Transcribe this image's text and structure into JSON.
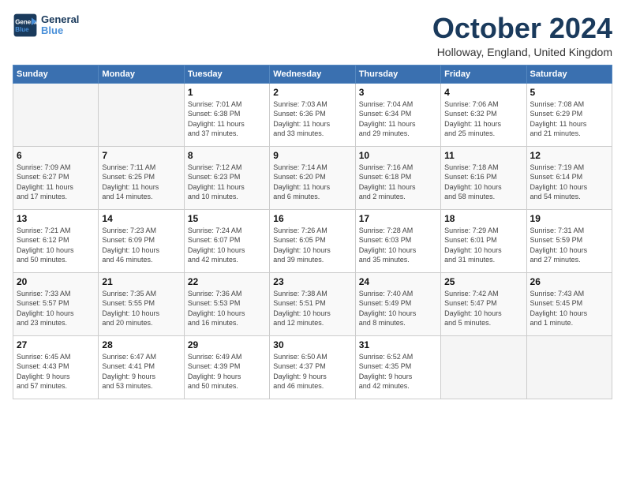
{
  "logo": {
    "text_general": "General",
    "text_blue": "Blue"
  },
  "title": "October 2024",
  "location": "Holloway, England, United Kingdom",
  "days_of_week": [
    "Sunday",
    "Monday",
    "Tuesday",
    "Wednesday",
    "Thursday",
    "Friday",
    "Saturday"
  ],
  "weeks": [
    [
      {
        "day": "",
        "info": ""
      },
      {
        "day": "",
        "info": ""
      },
      {
        "day": "1",
        "info": "Sunrise: 7:01 AM\nSunset: 6:38 PM\nDaylight: 11 hours\nand 37 minutes."
      },
      {
        "day": "2",
        "info": "Sunrise: 7:03 AM\nSunset: 6:36 PM\nDaylight: 11 hours\nand 33 minutes."
      },
      {
        "day": "3",
        "info": "Sunrise: 7:04 AM\nSunset: 6:34 PM\nDaylight: 11 hours\nand 29 minutes."
      },
      {
        "day": "4",
        "info": "Sunrise: 7:06 AM\nSunset: 6:32 PM\nDaylight: 11 hours\nand 25 minutes."
      },
      {
        "day": "5",
        "info": "Sunrise: 7:08 AM\nSunset: 6:29 PM\nDaylight: 11 hours\nand 21 minutes."
      }
    ],
    [
      {
        "day": "6",
        "info": "Sunrise: 7:09 AM\nSunset: 6:27 PM\nDaylight: 11 hours\nand 17 minutes."
      },
      {
        "day": "7",
        "info": "Sunrise: 7:11 AM\nSunset: 6:25 PM\nDaylight: 11 hours\nand 14 minutes."
      },
      {
        "day": "8",
        "info": "Sunrise: 7:12 AM\nSunset: 6:23 PM\nDaylight: 11 hours\nand 10 minutes."
      },
      {
        "day": "9",
        "info": "Sunrise: 7:14 AM\nSunset: 6:20 PM\nDaylight: 11 hours\nand 6 minutes."
      },
      {
        "day": "10",
        "info": "Sunrise: 7:16 AM\nSunset: 6:18 PM\nDaylight: 11 hours\nand 2 minutes."
      },
      {
        "day": "11",
        "info": "Sunrise: 7:18 AM\nSunset: 6:16 PM\nDaylight: 10 hours\nand 58 minutes."
      },
      {
        "day": "12",
        "info": "Sunrise: 7:19 AM\nSunset: 6:14 PM\nDaylight: 10 hours\nand 54 minutes."
      }
    ],
    [
      {
        "day": "13",
        "info": "Sunrise: 7:21 AM\nSunset: 6:12 PM\nDaylight: 10 hours\nand 50 minutes."
      },
      {
        "day": "14",
        "info": "Sunrise: 7:23 AM\nSunset: 6:09 PM\nDaylight: 10 hours\nand 46 minutes."
      },
      {
        "day": "15",
        "info": "Sunrise: 7:24 AM\nSunset: 6:07 PM\nDaylight: 10 hours\nand 42 minutes."
      },
      {
        "day": "16",
        "info": "Sunrise: 7:26 AM\nSunset: 6:05 PM\nDaylight: 10 hours\nand 39 minutes."
      },
      {
        "day": "17",
        "info": "Sunrise: 7:28 AM\nSunset: 6:03 PM\nDaylight: 10 hours\nand 35 minutes."
      },
      {
        "day": "18",
        "info": "Sunrise: 7:29 AM\nSunset: 6:01 PM\nDaylight: 10 hours\nand 31 minutes."
      },
      {
        "day": "19",
        "info": "Sunrise: 7:31 AM\nSunset: 5:59 PM\nDaylight: 10 hours\nand 27 minutes."
      }
    ],
    [
      {
        "day": "20",
        "info": "Sunrise: 7:33 AM\nSunset: 5:57 PM\nDaylight: 10 hours\nand 23 minutes."
      },
      {
        "day": "21",
        "info": "Sunrise: 7:35 AM\nSunset: 5:55 PM\nDaylight: 10 hours\nand 20 minutes."
      },
      {
        "day": "22",
        "info": "Sunrise: 7:36 AM\nSunset: 5:53 PM\nDaylight: 10 hours\nand 16 minutes."
      },
      {
        "day": "23",
        "info": "Sunrise: 7:38 AM\nSunset: 5:51 PM\nDaylight: 10 hours\nand 12 minutes."
      },
      {
        "day": "24",
        "info": "Sunrise: 7:40 AM\nSunset: 5:49 PM\nDaylight: 10 hours\nand 8 minutes."
      },
      {
        "day": "25",
        "info": "Sunrise: 7:42 AM\nSunset: 5:47 PM\nDaylight: 10 hours\nand 5 minutes."
      },
      {
        "day": "26",
        "info": "Sunrise: 7:43 AM\nSunset: 5:45 PM\nDaylight: 10 hours\nand 1 minute."
      }
    ],
    [
      {
        "day": "27",
        "info": "Sunrise: 6:45 AM\nSunset: 4:43 PM\nDaylight: 9 hours\nand 57 minutes."
      },
      {
        "day": "28",
        "info": "Sunrise: 6:47 AM\nSunset: 4:41 PM\nDaylight: 9 hours\nand 53 minutes."
      },
      {
        "day": "29",
        "info": "Sunrise: 6:49 AM\nSunset: 4:39 PM\nDaylight: 9 hours\nand 50 minutes."
      },
      {
        "day": "30",
        "info": "Sunrise: 6:50 AM\nSunset: 4:37 PM\nDaylight: 9 hours\nand 46 minutes."
      },
      {
        "day": "31",
        "info": "Sunrise: 6:52 AM\nSunset: 4:35 PM\nDaylight: 9 hours\nand 42 minutes."
      },
      {
        "day": "",
        "info": ""
      },
      {
        "day": "",
        "info": ""
      }
    ]
  ]
}
